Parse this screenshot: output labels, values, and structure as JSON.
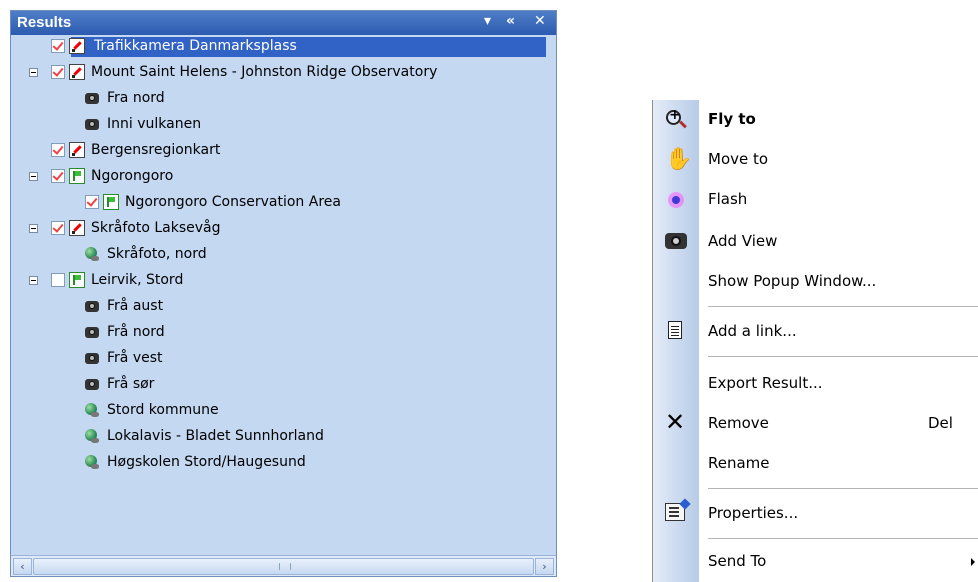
{
  "results_panel": {
    "title": "Results",
    "controls": {
      "menu": "▾",
      "collapse": "«",
      "close": "✕"
    },
    "items": [
      {
        "label": "Trafikkamera Danmarksplass",
        "icon": "pin-icon",
        "checked": true,
        "expander": false,
        "selected": true
      },
      {
        "label": "Mount Saint Helens - Johnston Ridge Observatory",
        "icon": "pin-icon",
        "checked": true,
        "expander": true
      },
      {
        "label": "Fra nord",
        "icon": "camera-icon"
      },
      {
        "label": "Inni vulkanen",
        "icon": "camera-icon"
      },
      {
        "label": "Bergensregionkart",
        "icon": "pin-icon",
        "checked": true,
        "expander": false
      },
      {
        "label": "Ngorongoro",
        "icon": "flag-icon",
        "checked": true,
        "expander": true
      },
      {
        "label": "Ngorongoro Conservation Area",
        "icon": "flag-icon",
        "checked": true
      },
      {
        "label": "Skråfoto Laksevåg",
        "icon": "pin-icon",
        "checked": true,
        "expander": true
      },
      {
        "label": "Skråfoto, nord",
        "icon": "globe-icon"
      },
      {
        "label": "Leirvik, Stord",
        "icon": "flag-icon",
        "checked": false,
        "expander": true
      },
      {
        "label": "Frå aust",
        "icon": "camera-icon"
      },
      {
        "label": "Frå nord",
        "icon": "camera-icon"
      },
      {
        "label": "Frå vest",
        "icon": "camera-icon"
      },
      {
        "label": "Frå sør",
        "icon": "camera-icon"
      },
      {
        "label": "Stord kommune",
        "icon": "globe-icon"
      },
      {
        "label": "Lokalavis - Bladet Sunnhorland",
        "icon": "globe-icon"
      },
      {
        "label": "Høgskolen Stord/Haugesund",
        "icon": "globe-icon"
      }
    ],
    "scrollbar": {
      "left_arrow": "‹",
      "right_arrow": "›"
    }
  },
  "context_menu": {
    "items": [
      {
        "label": "Fly to",
        "icon": "zoom-icon",
        "bold": true
      },
      {
        "label": "Move to",
        "icon": "hand-icon"
      },
      {
        "label": "Flash",
        "icon": "flash-icon"
      },
      {
        "label": "Add View",
        "icon": "camera-icon"
      },
      {
        "label": "Show Popup Window...",
        "icon": ""
      },
      {
        "label": "Add a link...",
        "icon": "document-icon"
      },
      {
        "label": "Export Result...",
        "icon": ""
      },
      {
        "label": "Remove",
        "icon": "delete-x-icon",
        "shortcut": "Del"
      },
      {
        "label": "Rename",
        "icon": ""
      },
      {
        "label": "Properties...",
        "icon": "properties-icon"
      },
      {
        "label": "Send To",
        "icon": "",
        "submenu": true
      }
    ]
  }
}
